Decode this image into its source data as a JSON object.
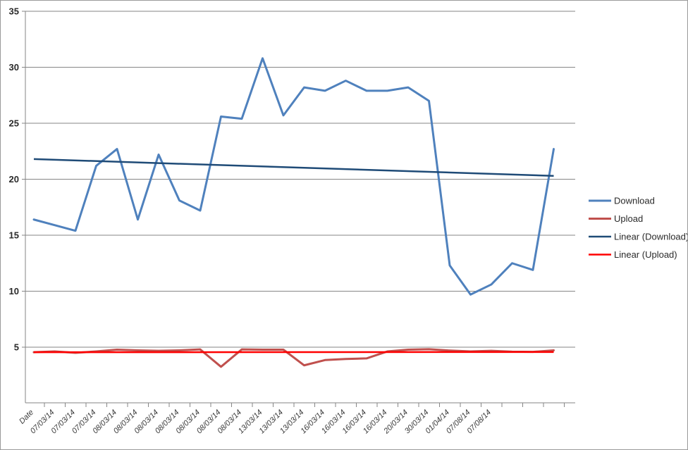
{
  "chart_data": {
    "type": "line",
    "title": "",
    "subtitle": "",
    "xlabel": "",
    "ylabel": "",
    "ylim": [
      0,
      35
    ],
    "y_ticks": [
      5,
      10,
      15,
      20,
      25,
      30,
      35
    ],
    "grid": true,
    "legend_position": "right",
    "x_axis_first_label": "Date",
    "categories": [
      "Date",
      "07/03/14",
      "07/03/14",
      "07/03/14",
      "08/03/14",
      "08/03/14",
      "08/03/14",
      "08/03/14",
      "08/03/14",
      "08/03/14",
      "08/03/14",
      "13/03/14",
      "13/03/14",
      "13/03/14",
      "16/03/14",
      "16/03/14",
      "16/03/14",
      "16/03/14",
      "20/03/14",
      "30/03/14",
      "01/04/14",
      "07/08/14",
      "07/08/14",
      "",
      "",
      "",
      ""
    ],
    "series": [
      {
        "name": "Download",
        "color": "#4F81BD",
        "width": 3,
        "values": [
          16.4,
          15.9,
          15.4,
          21.2,
          22.7,
          16.4,
          22.2,
          18.1,
          17.2,
          25.6,
          25.4,
          30.8,
          25.7,
          28.2,
          27.9,
          28.8,
          27.9,
          27.9,
          28.2,
          27.0,
          12.3,
          9.7,
          10.6,
          12.5,
          11.9,
          22.7
        ]
      },
      {
        "name": "Upload",
        "color": "#C0504D",
        "width": 3,
        "values": [
          4.55,
          4.62,
          4.5,
          4.62,
          4.78,
          4.72,
          4.68,
          4.72,
          4.8,
          3.25,
          4.8,
          4.78,
          4.78,
          3.38,
          3.85,
          3.95,
          4.0,
          4.62,
          4.78,
          4.82,
          4.7,
          4.62,
          4.68,
          4.6,
          4.58,
          4.72
        ]
      },
      {
        "name": "Linear (Download)",
        "color": "#1F4B77",
        "width": 2.5,
        "trendline_for": "Download",
        "endpoints": [
          21.8,
          20.3
        ]
      },
      {
        "name": "Linear (Upload)",
        "color": "#FF0000",
        "width": 2.5,
        "trendline_for": "Upload",
        "endpoints": [
          4.55,
          4.57
        ]
      }
    ]
  },
  "legend": {
    "items": [
      {
        "label": "Download",
        "color": "#4F81BD",
        "width": 3
      },
      {
        "label": "Upload",
        "color": "#C0504D",
        "width": 3
      },
      {
        "label": "Linear (Download)",
        "color": "#1F4B77",
        "width": 2.5
      },
      {
        "label": "Linear (Upload)",
        "color": "#FF0000",
        "width": 2.5
      }
    ]
  },
  "axes": {
    "y_tick_labels": [
      "5",
      "10",
      "15",
      "20",
      "25",
      "30",
      "35"
    ],
    "x_tick_labels": [
      "Date",
      "07/03/14",
      "07/03/14",
      "07/03/14",
      "08/03/14",
      "08/03/14",
      "08/03/14",
      "08/03/14",
      "08/03/14",
      "08/03/14",
      "08/03/14",
      "13/03/14",
      "13/03/14",
      "13/03/14",
      "16/03/14",
      "16/03/14",
      "16/03/14",
      "16/03/14",
      "20/03/14",
      "30/03/14",
      "01/04/14",
      "07/08/14",
      "07/08/14"
    ]
  }
}
